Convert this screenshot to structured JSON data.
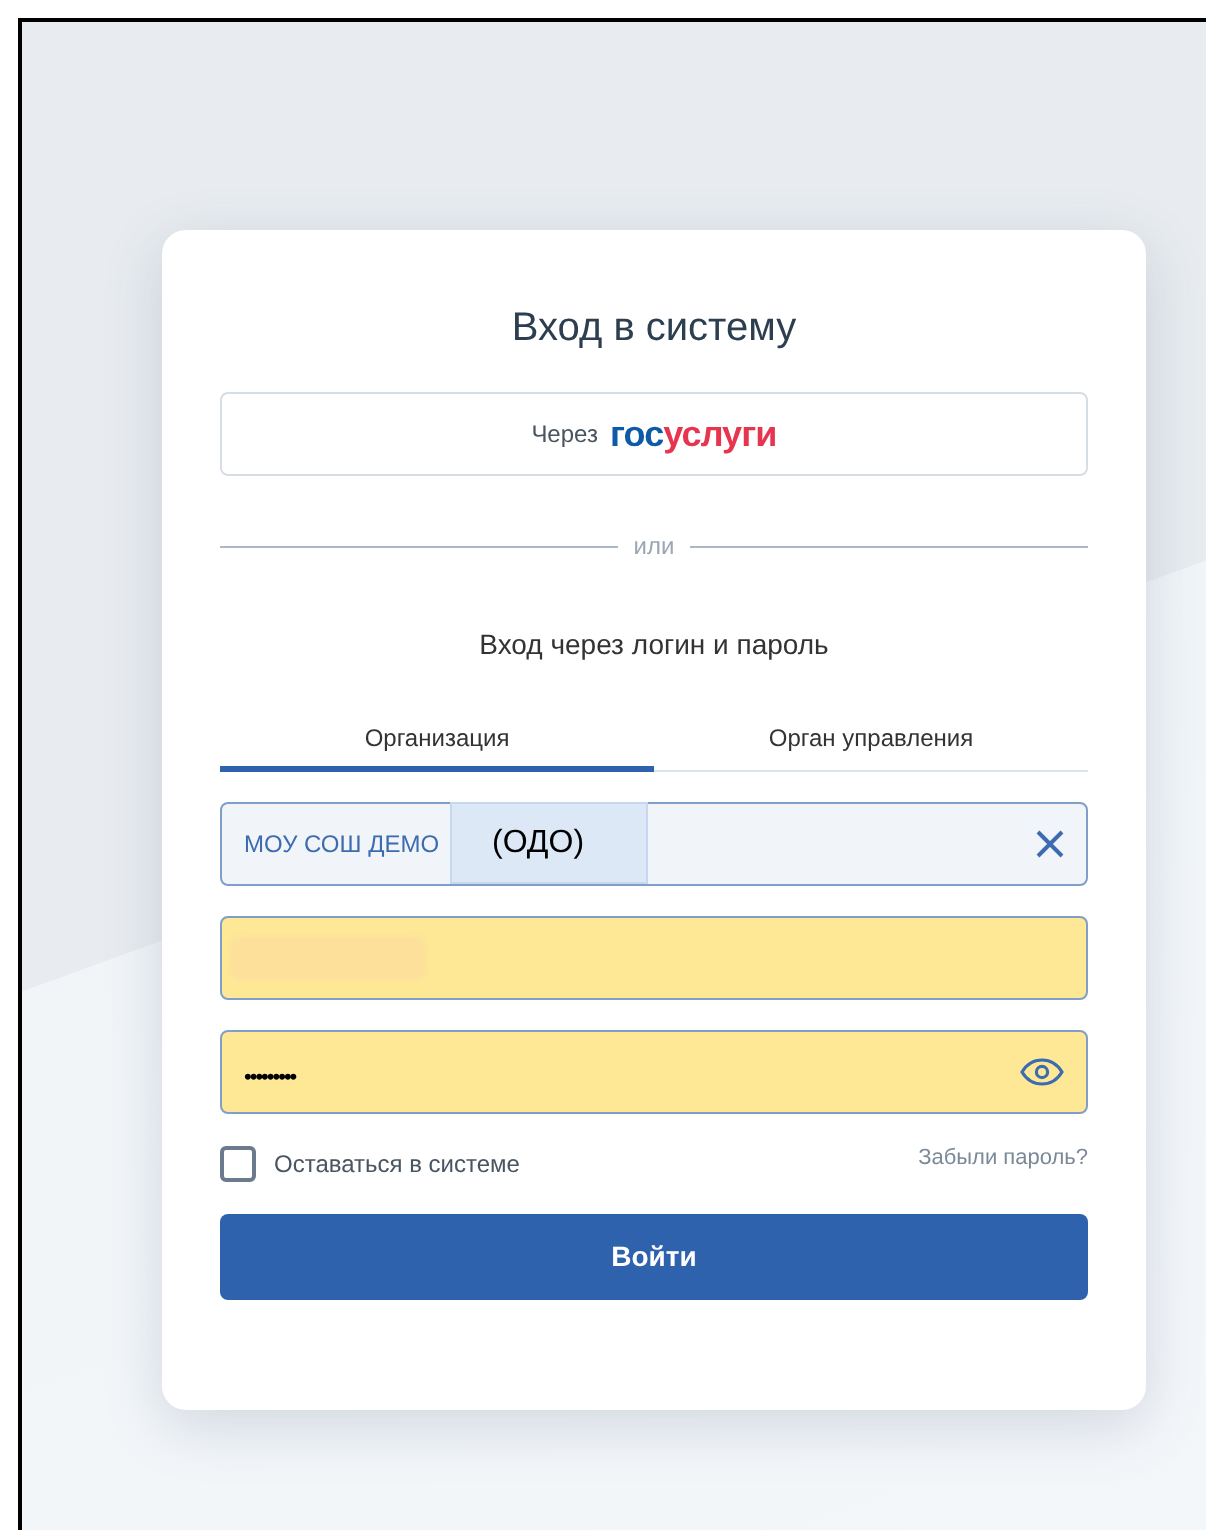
{
  "title": "Вход в систему",
  "gosuslugi_button": {
    "prefix": "Через",
    "logo_part_1": "гос",
    "logo_part_2": "услуги"
  },
  "divider_text": "или",
  "subtitle": "Вход через логин и пароль",
  "tabs": [
    {
      "label": "Организация",
      "selected": true
    },
    {
      "label": "Орган управления",
      "selected": false
    }
  ],
  "organization_field": {
    "value": "МОУ СОШ ДЕМО",
    "overlay": "(ОДО)"
  },
  "login_field": {
    "redacted": true
  },
  "password_field": {
    "value": "•••••••••"
  },
  "remember": {
    "label": "Оставаться в системе",
    "checked": false
  },
  "forgot_link": "Забыли пароль?",
  "submit": "Войти"
}
